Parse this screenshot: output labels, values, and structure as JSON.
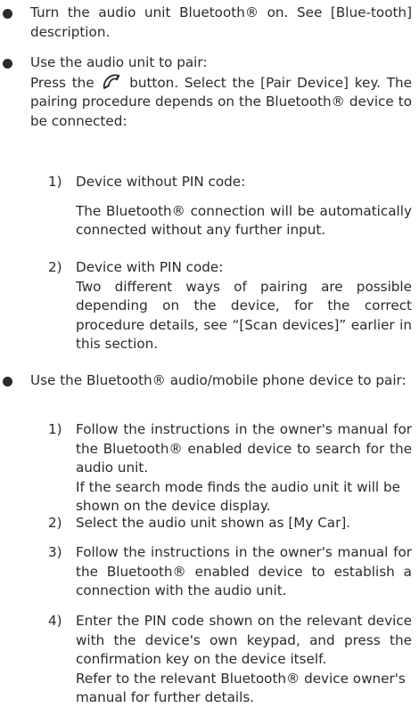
{
  "bullets": [
    {
      "text": "Turn the audio unit Bluetooth® on. See [Blue-tooth] description."
    },
    {
      "intro": "Use the audio unit to pair:",
      "line_pre": "Press the",
      "icon": "phone-icon",
      "line_post": "button. Select the [Pair Device] key. The pairing procedure depends on the Bluetooth® device to be connected:",
      "items": [
        {
          "num": "1)",
          "title": "Device without PIN code:",
          "body": "The Bluetooth® connection will be automatically connected without any further input."
        },
        {
          "num": "2)",
          "title": "Device with PIN code:",
          "body": "Two different ways of pairing are possible depending on the device, for the correct procedure details, see “[Scan devices]” earlier in this section."
        }
      ]
    },
    {
      "intro": "Use the Bluetooth® audio/mobile phone device to pair:",
      "items": [
        {
          "num": "1)",
          "text": "Follow the instructions in the owner's manual for the Bluetooth® enabled device to search for the audio unit.",
          "extra": "If the search mode finds the audio unit it will be shown on the device display."
        },
        {
          "num": "2)",
          "text": "Select the audio unit shown as [My Car]."
        },
        {
          "num": "3)",
          "text": "Follow the instructions in the owner's manual for the Bluetooth® enabled device to establish a connection with the audio unit."
        },
        {
          "num": "4)",
          "text": "Enter the PIN code shown on the relevant device with the device's own keypad, and press the confirmation key on the device itself.",
          "extra": "Refer to the relevant Bluetooth® device owner's manual for further details."
        }
      ]
    }
  ]
}
